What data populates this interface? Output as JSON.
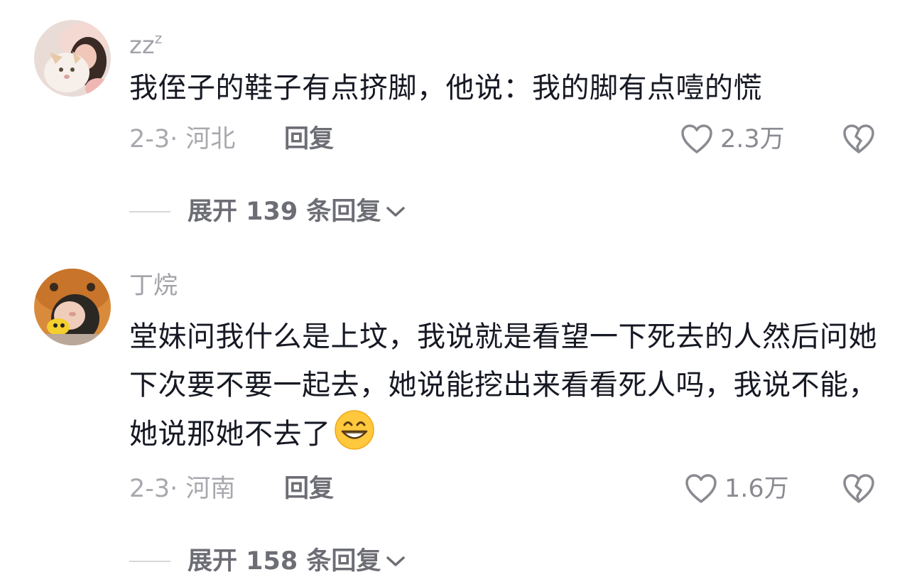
{
  "comments": [
    {
      "username": "zz",
      "username_sup": "z",
      "text": "我侄子的鞋子有点挤脚，他说：我的脚有点噎的慌",
      "date_loc": "2-3· 河北",
      "reply_label": "回复",
      "likes": "2.3万",
      "expand_label": "展开 139 条回复",
      "avatar_icon": "cat-avatar-icon"
    },
    {
      "username": "丁烷",
      "text": "堂妹问我什么是上坟，我说就是看望一下死去的人然后问她下次要不要一起去，她说能挖出来看看死人吗，我说不能，她说那她不去了",
      "emoji": "grinning-face-emoji",
      "date_loc": "2-3· 河南",
      "reply_label": "回复",
      "likes": "1.6万",
      "expand_label": "展开 158 条回复",
      "avatar_icon": "hooded-child-avatar-icon"
    }
  ],
  "colors": {
    "text": "#161823",
    "muted": "#a8a9ae",
    "secondary": "#6d6e75",
    "emoji_yellow": "#ffc83d"
  }
}
